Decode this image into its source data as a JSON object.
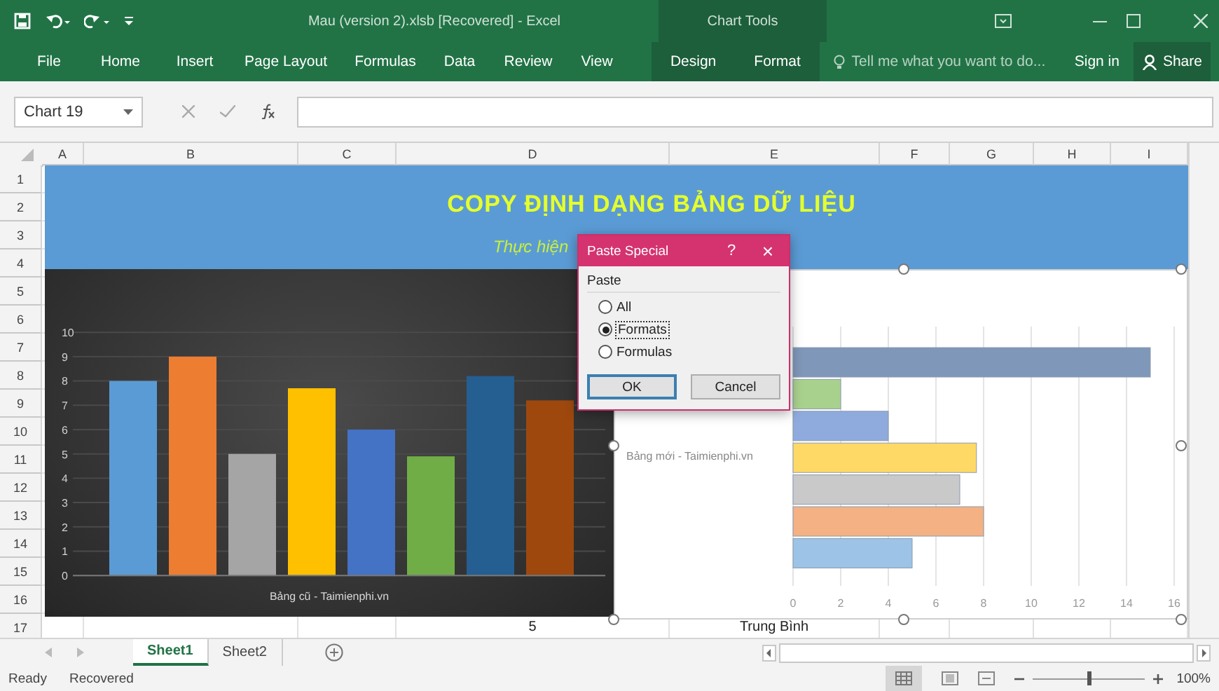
{
  "title_bar": {
    "title": "Mau (version 2).xlsb [Recovered] - Excel",
    "context_title": "Chart Tools"
  },
  "ribbon": {
    "tabs": [
      {
        "label": "File",
        "contextual": false
      },
      {
        "label": "Home",
        "contextual": false
      },
      {
        "label": "Insert",
        "contextual": false
      },
      {
        "label": "Page Layout",
        "contextual": false
      },
      {
        "label": "Formulas",
        "contextual": false
      },
      {
        "label": "Data",
        "contextual": false
      },
      {
        "label": "Review",
        "contextual": false
      },
      {
        "label": "View",
        "contextual": false
      },
      {
        "label": "Design",
        "contextual": true
      },
      {
        "label": "Format",
        "contextual": true
      }
    ],
    "tell_me": "Tell me what you want to do...",
    "sign_in": "Sign in",
    "share": "Share"
  },
  "formula_bar": {
    "name_box": "Chart 19"
  },
  "sheet": {
    "columns": [
      "A",
      "B",
      "C",
      "D",
      "E",
      "F",
      "G",
      "H",
      "I"
    ],
    "rows": [
      "1",
      "2",
      "3",
      "4",
      "5",
      "6",
      "7",
      "8",
      "9",
      "10",
      "11",
      "12",
      "13",
      "14",
      "15",
      "16",
      "17"
    ],
    "banner": {
      "title": "COPY ĐỊNH DẠNG BẢNG DỮ LIỆU",
      "subtitle": "Thực hiện"
    },
    "row_17_cells": [
      "5",
      "Trung Bình"
    ],
    "charts": [
      {
        "chart_data": {
          "type": "bar",
          "title": "Bảng cũ - Taimienphi.vn",
          "values": [
            8,
            9,
            5,
            7.7,
            6,
            4.9,
            8.2,
            7.2
          ],
          "colors": [
            "#5b9bd5",
            "#ed7d31",
            "#a5a5a5",
            "#ffc000",
            "#4472c4",
            "#70ad47",
            "#255e91",
            "#9e480e"
          ],
          "ylim": [
            0,
            10
          ],
          "grid": true,
          "yticks": [
            0,
            1,
            2,
            3,
            4,
            5,
            6,
            7,
            8,
            9,
            10
          ]
        }
      },
      {
        "chart_data": {
          "type": "bar",
          "orientation": "horizontal",
          "title": "Bảng mới - Taimienphi.vn",
          "values": [
            15,
            2,
            4,
            7.7,
            7,
            8,
            5
          ],
          "colors": [
            "#7f97b8",
            "#a9d18e",
            "#8faadc",
            "#ffd966",
            "#c9c9c9",
            "#f4b183",
            "#9dc3e6"
          ],
          "xlim": [
            0,
            16
          ],
          "grid": true,
          "xticks": [
            0,
            2,
            4,
            6,
            8,
            10,
            12,
            14,
            16
          ]
        }
      }
    ]
  },
  "dialog": {
    "title": "Paste Special",
    "help": "?",
    "close": "×",
    "group": "Paste",
    "options": [
      {
        "label": "All",
        "selected": false
      },
      {
        "label": "Formats",
        "selected": true
      },
      {
        "label": "Formulas",
        "selected": false
      }
    ],
    "buttons": [
      {
        "label": "OK",
        "default": true
      },
      {
        "label": "Cancel",
        "default": false
      }
    ]
  },
  "sheet_tabs": [
    {
      "label": "Sheet1",
      "selected": true
    },
    {
      "label": "Sheet2",
      "selected": false
    }
  ],
  "status_bar": {
    "items": [
      "Ready",
      "Recovered"
    ],
    "zoom_slider": {
      "level": 0.5
    },
    "zoom": "100%"
  }
}
